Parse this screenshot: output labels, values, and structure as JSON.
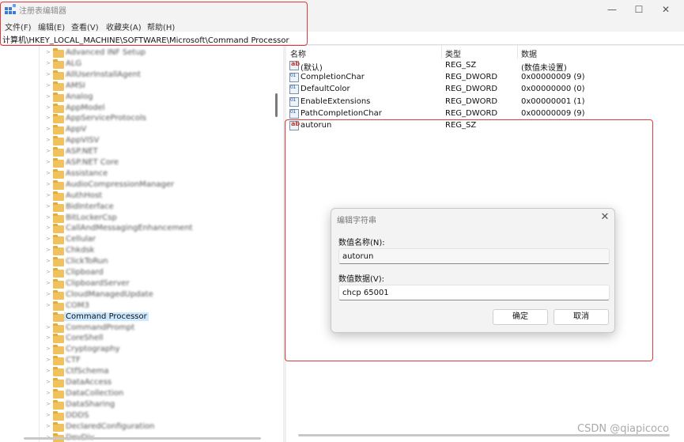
{
  "window": {
    "title": "注册表编辑器",
    "min_glyph": "—",
    "max_glyph": "☐",
    "close_glyph": "✕",
    "icon": "registry-editor-icon"
  },
  "menu": [
    "文件(F)",
    "编辑(E)",
    "查看(V)",
    "收藏夹(A)",
    "帮助(H)"
  ],
  "address": "计算机\\HKEY_LOCAL_MACHINE\\SOFTWARE\\Microsoft\\Command Processor",
  "tree": {
    "selected_label": "Command Processor",
    "blurred_labels": [
      "Advanced INF Setup",
      "ALG",
      "AllUserInstallAgent",
      "AMSI",
      "Analog",
      "AppModel",
      "AppServiceProtocols",
      "AppV",
      "AppVISV",
      "ASP.NET",
      "ASP.NET Core",
      "Assistance",
      "AudioCompressionManager",
      "AuthHost",
      "BidInterface",
      "BitLockerCsp",
      "CallAndMessagingEnhancement",
      "Cellular",
      "Chkdsk",
      "ClickToRun",
      "Clipboard",
      "ClipboardServer",
      "CloudManagedUpdate",
      "COM3",
      "Command Processor",
      "CommandPrompt",
      "CoreShell",
      "Cryptography",
      "CTF",
      "CtfSchema",
      "DataAccess",
      "DataCollection",
      "DataSharing",
      "DDDS",
      "DeclaredConfiguration",
      "DevDiv"
    ]
  },
  "values_table": {
    "headers": {
      "name": "名称",
      "type": "类型",
      "data": "数据"
    },
    "rows": [
      {
        "name": "(默认)",
        "type": "REG_SZ",
        "data": "(数值未设置)",
        "kind": "sz"
      },
      {
        "name": "CompletionChar",
        "type": "REG_DWORD",
        "data": "0x00000009 (9)",
        "kind": "dw"
      },
      {
        "name": "DefaultColor",
        "type": "REG_DWORD",
        "data": "0x00000000 (0)",
        "kind": "dw"
      },
      {
        "name": "EnableExtensions",
        "type": "REG_DWORD",
        "data": "0x00000001 (1)",
        "kind": "dw"
      },
      {
        "name": "PathCompletionChar",
        "type": "REG_DWORD",
        "data": "0x00000009 (9)",
        "kind": "dw"
      },
      {
        "name": "autorun",
        "type": "REG_SZ",
        "data": "",
        "kind": "sz"
      }
    ]
  },
  "dialog": {
    "title": "编辑字符串",
    "close_glyph": "✕",
    "name_label": "数值名称(N):",
    "name_value": "autorun",
    "data_label": "数值数据(V):",
    "data_value": "chcp 65001",
    "ok_label": "确定",
    "cancel_label": "取消"
  },
  "watermark": "CSDN @qiapicoco",
  "colors": {
    "highlight": "#e0393e",
    "selection": "#cce8ff",
    "folder": "#f1c25c"
  }
}
